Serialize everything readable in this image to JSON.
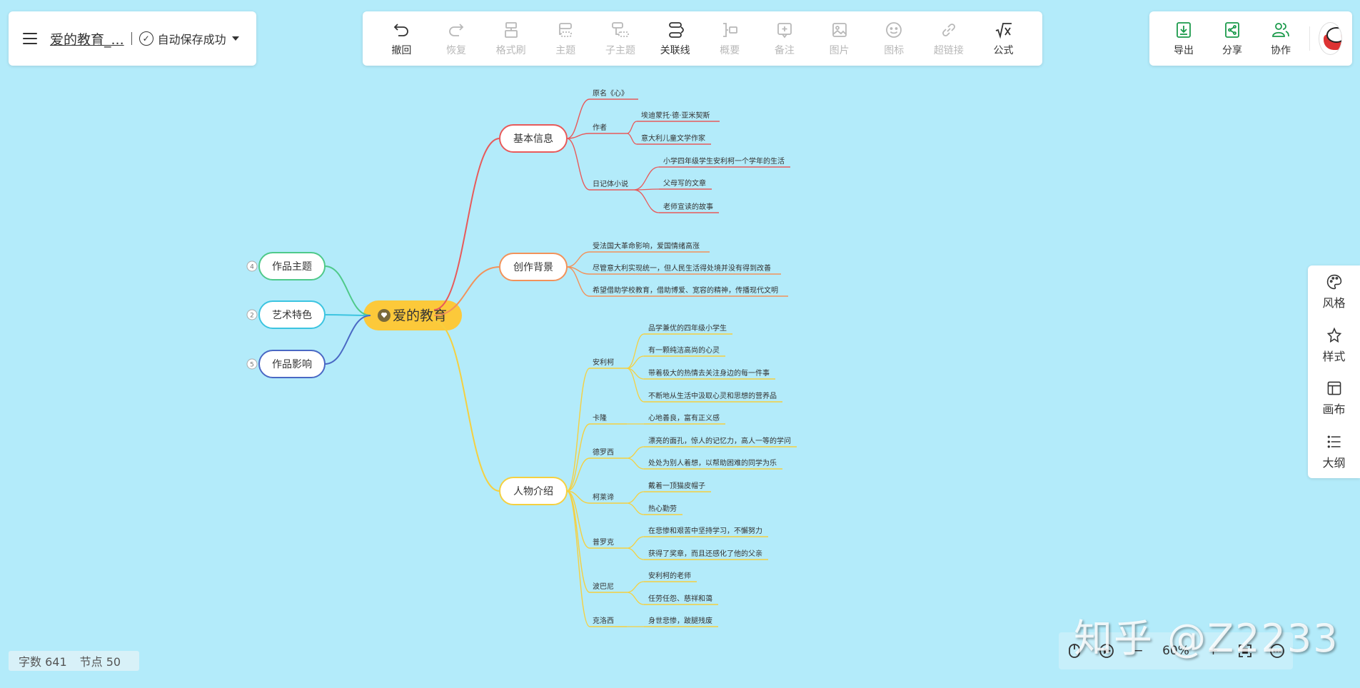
{
  "header": {
    "doc_title": "爱的教育_...",
    "save_status": "自动保存成功"
  },
  "toolbar": [
    {
      "label": "撤回",
      "icon": "undo-icon",
      "enabled": true
    },
    {
      "label": "恢复",
      "icon": "redo-icon",
      "enabled": false
    },
    {
      "label": "格式刷",
      "icon": "format-brush-icon",
      "enabled": false
    },
    {
      "label": "主题",
      "icon": "topic-icon",
      "enabled": false
    },
    {
      "label": "子主题",
      "icon": "subtopic-icon",
      "enabled": false
    },
    {
      "label": "关联线",
      "icon": "relation-line-icon",
      "enabled": true
    },
    {
      "label": "概要",
      "icon": "summary-icon",
      "enabled": false
    },
    {
      "label": "备注",
      "icon": "note-icon",
      "enabled": false
    },
    {
      "label": "图片",
      "icon": "image-icon",
      "enabled": false
    },
    {
      "label": "图标",
      "icon": "emoji-icon",
      "enabled": false
    },
    {
      "label": "超链接",
      "icon": "link-icon",
      "enabled": false
    },
    {
      "label": "公式",
      "icon": "formula-icon",
      "enabled": true
    }
  ],
  "right_actions": [
    {
      "label": "导出",
      "icon": "export-icon"
    },
    {
      "label": "分享",
      "icon": "share-icon"
    },
    {
      "label": "协作",
      "icon": "collaborate-icon"
    }
  ],
  "side_panel": [
    {
      "label": "风格",
      "icon": "palette-icon"
    },
    {
      "label": "样式",
      "icon": "style-icon"
    },
    {
      "label": "画布",
      "icon": "canvas-icon"
    },
    {
      "label": "大纲",
      "icon": "outline-icon"
    }
  ],
  "stats": {
    "word_count": "字数 641",
    "node_count": "节点 50"
  },
  "zoom": {
    "level": "60%"
  },
  "watermark": "知乎 @Z2233",
  "colors": {
    "background": "#b3ebfa",
    "root": "#fcc93a",
    "red": "#e85a5a",
    "orange": "#f2925a",
    "yellow": "#f5d040",
    "green": "#4fc98a",
    "cyan": "#3cc4e0",
    "blue": "#4a68c4",
    "accent": "#1b9a4b"
  },
  "mindmap": {
    "root": "爱的教育",
    "left_branches": [
      {
        "label": "作品主题",
        "count": "4",
        "color": "green"
      },
      {
        "label": "艺术特色",
        "count": "2",
        "color": "cyan"
      },
      {
        "label": "作品影响",
        "count": "5",
        "color": "blue"
      }
    ],
    "branches": [
      {
        "label": "基本信息",
        "color": "red",
        "children": [
          {
            "label": "原名《心》",
            "children": []
          },
          {
            "label": "作者",
            "children": [
              "埃迪蒙托·德·亚米契斯",
              "意大利儿童文学作家"
            ]
          },
          {
            "label": "日记体小说",
            "children": [
              "小学四年级学生安利柯一个学年的生活",
              "父母写的文章",
              "老师宣读的故事"
            ]
          }
        ]
      },
      {
        "label": "创作背景",
        "color": "orange",
        "children": [
          {
            "label": "受法国大革命影响，爱国情绪高涨",
            "children": []
          },
          {
            "label": "尽管意大利实现统一，但人民生活得处境并没有得到改善",
            "children": []
          },
          {
            "label": "希望借助学校教育，借助博爱、宽容的精神，传播现代文明",
            "children": []
          }
        ]
      },
      {
        "label": "人物介绍",
        "color": "yellow",
        "children": [
          {
            "label": "安利柯",
            "children": [
              "品学兼优的四年级小学生",
              "有一颗纯洁高尚的心灵",
              "带着极大的热情去关注身边的每一件事",
              "不断地从生活中汲取心灵和思想的营养品"
            ]
          },
          {
            "label": "卡隆",
            "children": [
              "心地善良，富有正义感"
            ]
          },
          {
            "label": "德罗西",
            "children": [
              "漂亮的面孔，惊人的记忆力，高人一等的学问",
              "处处为别人着想，以帮助困难的同学为乐"
            ]
          },
          {
            "label": "柯莱谛",
            "children": [
              "戴着一顶猫皮帽子",
              "热心勤劳"
            ]
          },
          {
            "label": "普罗克",
            "children": [
              "在悲惨和艰苦中坚持学习，不懈努力",
              "获得了奖章，而且还感化了他的父亲"
            ]
          },
          {
            "label": "波巴尼",
            "children": [
              "安利柯的老师",
              "任劳任怨、慈祥和蔼"
            ]
          },
          {
            "label": "克洛西",
            "children": [
              "身世悲惨，跛腿残废"
            ]
          }
        ]
      }
    ]
  }
}
